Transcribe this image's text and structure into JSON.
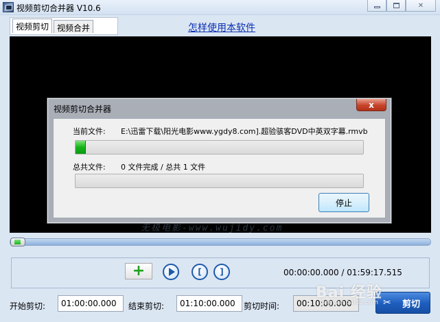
{
  "window": {
    "title": "视频剪切合并器 V10.6"
  },
  "tabs": [
    {
      "label": "视频剪切"
    },
    {
      "label": "视频合并"
    }
  ],
  "help_link": "怎样使用本软件",
  "video": {
    "watermark": "无极电影-www.wujidy.com"
  },
  "dialog": {
    "title": "视频剪切合并器",
    "close_label": "x",
    "current_file_label": "当前文件:",
    "current_file_value": "E:\\迅雷下载\\阳光电影www.ygdy8.com].超验骇客DVD中英双字幕.rmvb",
    "current_progress": 3.5,
    "total_files_label": "总共文件:",
    "total_files_value": "0 文件完成 / 总共 1 文件",
    "total_progress": 0,
    "stop_label": "停止"
  },
  "player": {
    "seek_position": 0,
    "time_readout": "00:00:00.000 / 01:59:17.515"
  },
  "bottom": {
    "start_label": "开始剪切:",
    "start_value": "01:00:00.000",
    "end_label": "结束剪切:",
    "end_value": "01:10:00.000",
    "duration_label": "剪切时间:",
    "duration_value": "00:10:00.000",
    "cut_label": "剪切"
  },
  "brand_watermark": "Bai 经验",
  "brand_watermark_sub": "jingyan.baidu.com",
  "colors": {
    "accent": "#1f5fc0",
    "progress_green": "#17b31a",
    "link": "#0b2fb0"
  }
}
